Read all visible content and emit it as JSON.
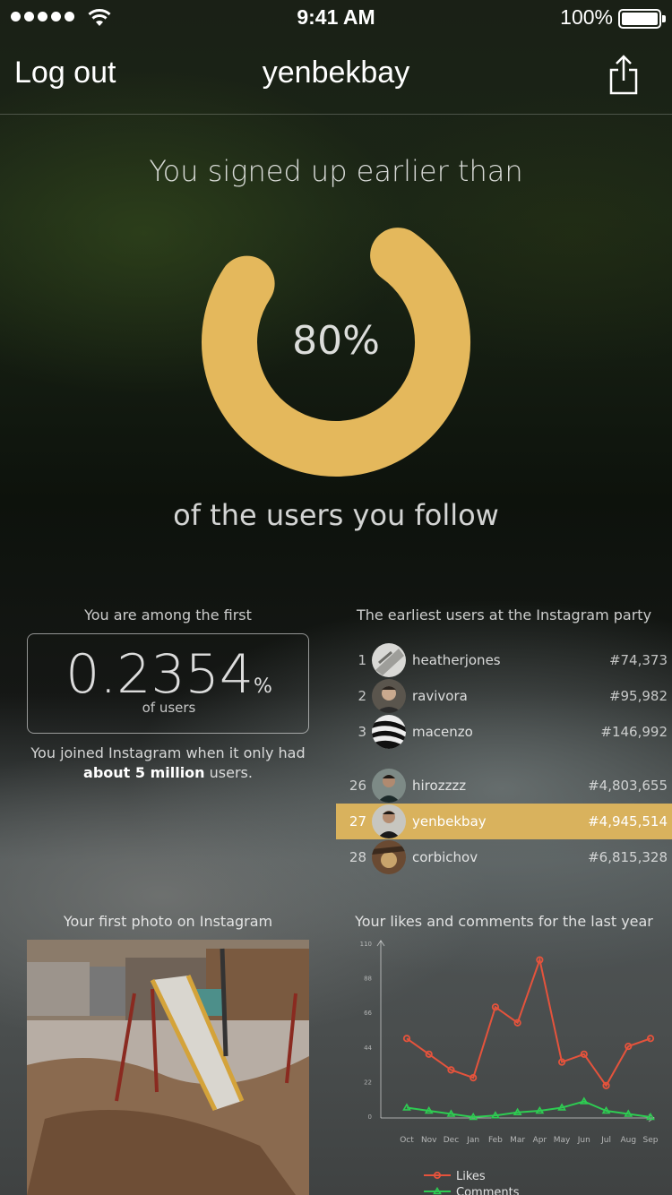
{
  "status_bar": {
    "time": "9:41 AM",
    "battery": "100%"
  },
  "nav": {
    "logout": "Log out",
    "title": "yenbekbay"
  },
  "signup": {
    "headline": "You signed up earlier than",
    "percent_text": "80%",
    "percent": 80,
    "subline": "of the users you follow",
    "ring_color": "#e4b85c"
  },
  "among": {
    "label": "You are among the first",
    "value": "0.2354",
    "percent_sign": "%",
    "unit": "of users",
    "joined_prefix": "You joined Instagram when it only had",
    "joined_bold": "about 5 million",
    "joined_suffix": "users."
  },
  "leaderboard": {
    "title": "The earliest users at the Instagram party",
    "highlight_color": "#d9b25d",
    "rows": [
      {
        "rank": "1",
        "name": "heatherjones",
        "id": "#74,373"
      },
      {
        "rank": "2",
        "name": "ravivora",
        "id": "#95,982"
      },
      {
        "rank": "3",
        "name": "macenzo",
        "id": "#146,992"
      },
      {
        "rank": "26",
        "name": "hirozzzz",
        "id": "#4,803,655"
      },
      {
        "rank": "27",
        "name": "yenbekbay",
        "id": "#4,945,514"
      },
      {
        "rank": "28",
        "name": "corbichov",
        "id": "#6,815,328"
      }
    ]
  },
  "first_photo": {
    "title": "Your first photo on Instagram"
  },
  "activity": {
    "title": "Your likes and comments for the last year"
  },
  "chart_data": {
    "type": "line",
    "x": [
      "Oct",
      "Nov",
      "Dec",
      "Jan",
      "Feb",
      "Mar",
      "Apr",
      "May",
      "Jun",
      "Jul",
      "Aug",
      "Sep"
    ],
    "y_ticks": [
      0,
      22,
      44,
      66,
      88,
      110
    ],
    "ylim": [
      0,
      110
    ],
    "series": [
      {
        "name": "Likes",
        "color": "#e5533c",
        "values": [
          50,
          40,
          30,
          25,
          70,
          60,
          100,
          35,
          40,
          20,
          45,
          50
        ]
      },
      {
        "name": "Comments",
        "color": "#2ecc52",
        "values": [
          6,
          4,
          2,
          0,
          1,
          3,
          4,
          6,
          10,
          4,
          2,
          0
        ]
      }
    ],
    "legend": "bottom",
    "grid": false
  }
}
